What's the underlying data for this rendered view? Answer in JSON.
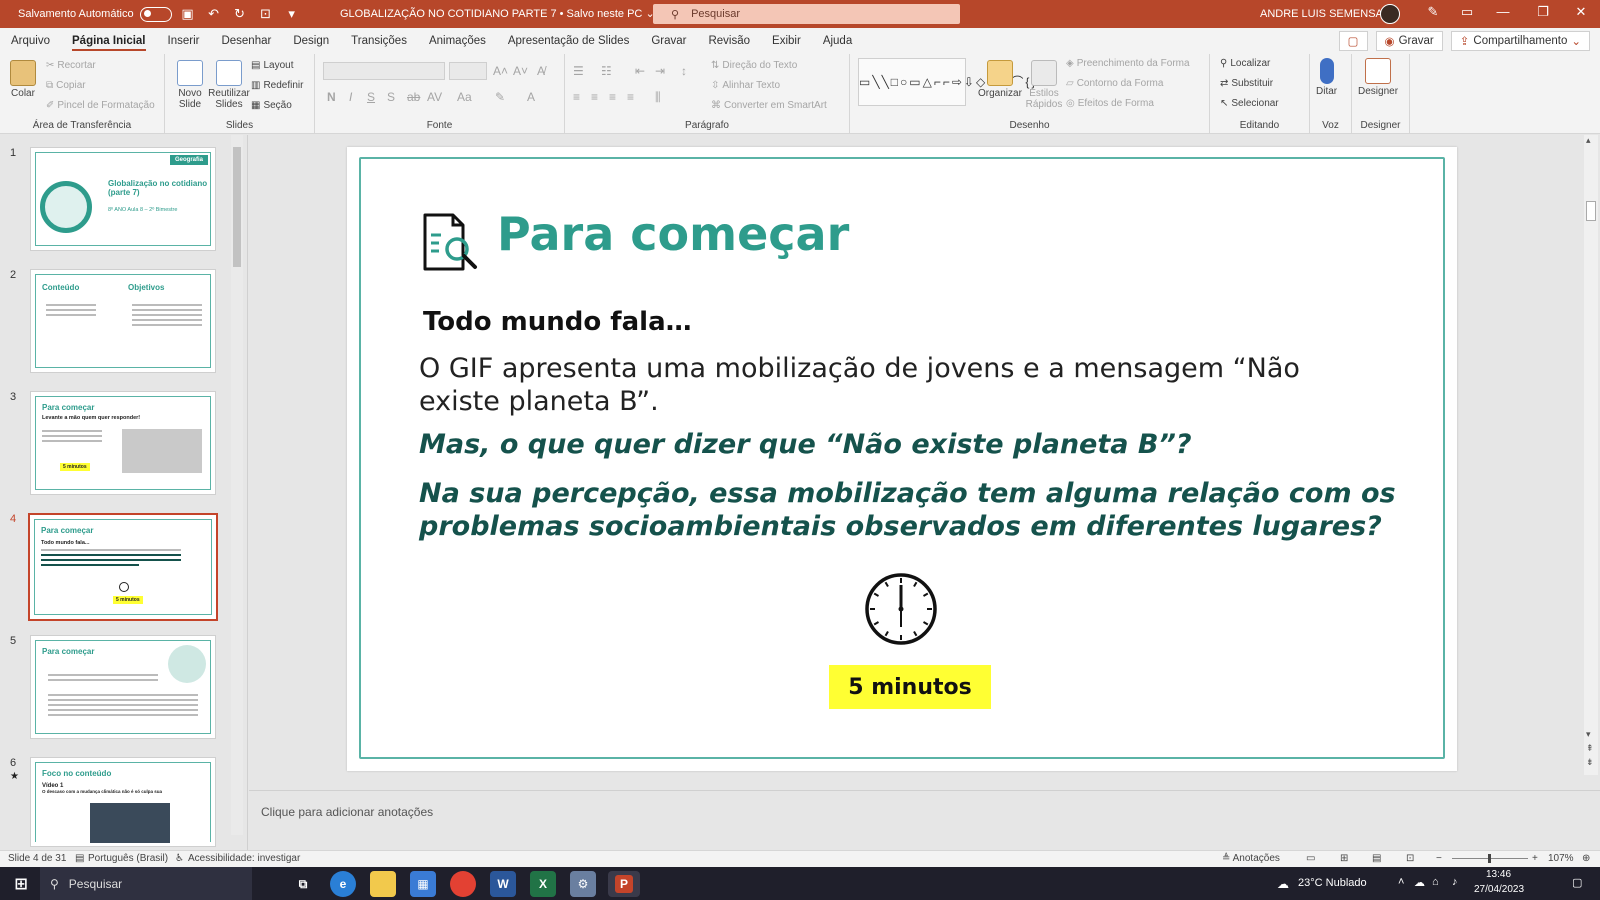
{
  "titlebar": {
    "autosave_label": "Salvamento Automático",
    "document_title": "GLOBALIZAÇÃO NO COTIDIANO PARTE 7 • Salvo neste PC",
    "search_placeholder": "Pesquisar",
    "user_name": "ANDRE LUIS SEMENSATO",
    "minimize": "—",
    "restore": "❐",
    "close": "✕"
  },
  "menu": {
    "tabs": [
      "Arquivo",
      "Página Inicial",
      "Inserir",
      "Desenhar",
      "Design",
      "Transições",
      "Animações",
      "Apresentação de Slides",
      "Gravar",
      "Revisão",
      "Exibir",
      "Ajuda"
    ],
    "record_label": "Gravar",
    "share_label": "Compartilhamento"
  },
  "ribbon": {
    "clipboard": {
      "label": "Área de Transferência",
      "paste": "Colar",
      "cut": "Recortar",
      "copy": "Copiar",
      "format_painter": "Pincel de Formatação"
    },
    "slides": {
      "label": "Slides",
      "new_slide": "Novo Slide",
      "reuse": "Reutilizar Slides",
      "layout": "Layout",
      "reset": "Redefinir",
      "section": "Seção"
    },
    "font": {
      "label": "Fonte"
    },
    "paragraph": {
      "label": "Parágrafo",
      "text_direction": "Direção do Texto",
      "align_text": "Alinhar Texto",
      "smartart": "Converter em SmartArt"
    },
    "drawing": {
      "label": "Desenho",
      "arrange": "Organizar",
      "quick_styles": "Estilos Rápidos",
      "shape_fill": "Preenchimento da Forma",
      "shape_outline": "Contorno da Forma",
      "shape_effects": "Efeitos de Forma"
    },
    "editing": {
      "label": "Editando",
      "find": "Localizar",
      "replace": "Substituir",
      "select": "Selecionar"
    },
    "voice": {
      "label": "Voz",
      "dictate": "Ditar"
    },
    "designer": {
      "label": "Designer",
      "designer": "Designer"
    }
  },
  "thumbnails": [
    {
      "num": "1",
      "title": "Globalização no cotidiano (parte 7)",
      "sub": "8º ANO Aula 8 – 2º Bimestre",
      "tag": "Geografia"
    },
    {
      "num": "2",
      "title": "Conteúdo",
      "title2": "Objetivos"
    },
    {
      "num": "3",
      "title": "Para começar",
      "sub": "Levante a mão quem quer responder!",
      "badge": "5 minutos"
    },
    {
      "num": "4",
      "title": "Para começar",
      "sub": "Todo mundo fala...",
      "badge": "5 minutos"
    },
    {
      "num": "5",
      "title": "Para começar"
    },
    {
      "num": "6",
      "title": "Foco no conteúdo",
      "sub": "Vídeo 1",
      "caption": "O descaso com a mudança climática não é só culpa sua"
    }
  ],
  "slide": {
    "heading": "Para começar",
    "subheading": "Todo mundo fala…",
    "body": "O GIF apresenta uma mobilização de jovens e a mensagem “Não existe planeta B”.",
    "question1": "Mas, o que quer dizer que “Não existe planeta B”?",
    "question2": "Na sua percepção, essa mobilização tem alguma relação com os problemas socioambientais observados em diferentes lugares?",
    "timer_badge": "5 minutos",
    "badge_color": "#ffff33",
    "accent_color": "#2e9c8c"
  },
  "notes_placeholder": "Clique para adicionar anotações",
  "status": {
    "slide_count": "Slide 4 de 31",
    "language": "Português (Brasil)",
    "accessibility": "Acessibilidade: investigar",
    "notes": "Anotações",
    "zoom": "107%"
  },
  "taskbar": {
    "search": "Pesquisar",
    "weather": "23°C  Nublado",
    "time": "13:46",
    "date": "27/04/2023"
  }
}
